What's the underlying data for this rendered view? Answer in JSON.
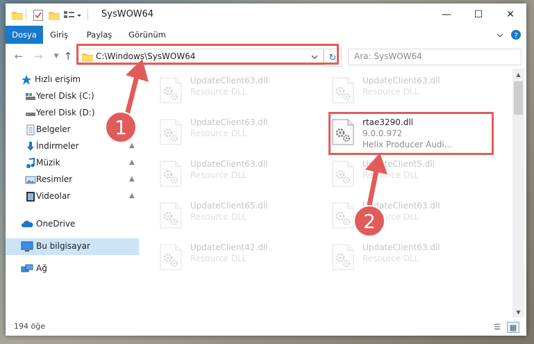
{
  "window": {
    "title": "SysWOW64",
    "controls": {
      "minimize": "—",
      "maximize": "☐",
      "close": "✕"
    }
  },
  "ribbon": {
    "tabs": [
      {
        "label": "Dosya"
      },
      {
        "label": "Giriş"
      },
      {
        "label": "Paylaş"
      },
      {
        "label": "Görünüm"
      }
    ],
    "expand_icon": "chevron-down-icon",
    "help_icon": "help-icon"
  },
  "navbar": {
    "address": "C:\\Windows\\SysWOW64",
    "search_placeholder": "Ara: SysWOW64"
  },
  "sidebar": {
    "items": [
      {
        "label": "Hızlı erişim",
        "icon": "star-icon"
      },
      {
        "label": "Yerel Disk (C:)",
        "icon": "drive-icon"
      },
      {
        "label": "Yerel Disk (D:)",
        "icon": "drive-icon"
      },
      {
        "label": "Belgeler",
        "icon": "documents-icon"
      },
      {
        "label": "İndirmeler",
        "icon": "download-icon"
      },
      {
        "label": "Müzik",
        "icon": "music-icon"
      },
      {
        "label": "Resimler",
        "icon": "pictures-icon"
      },
      {
        "label": "Videolar",
        "icon": "videos-icon"
      },
      {
        "label": "OneDrive",
        "icon": "cloud-icon"
      },
      {
        "label": "Bu bilgisayar",
        "icon": "computer-icon"
      },
      {
        "label": "Ağ",
        "icon": "network-icon"
      }
    ]
  },
  "files": [
    {
      "name": "UpdateClient63.dll",
      "type": "Resource DLL"
    },
    {
      "name": "UpdateClient63.dll",
      "type": "Resource DLL"
    },
    {
      "name": "UpdateClient63.dll",
      "type": "Resource DLL"
    },
    {
      "name": "rtae3290.dll",
      "version": "9.0.0.972",
      "description": "Helix Producer Audi..."
    },
    {
      "name": "UpdateClient63.dll",
      "type": "Resource DLL"
    },
    {
      "name": "UpdateClient5.dll",
      "type": "Resource DLL"
    },
    {
      "name": "UpdateClient65.dll",
      "type": "Resource DLL"
    },
    {
      "name": "UpdateClient63.dll",
      "type": "Resource DLL"
    },
    {
      "name": "UpdateClient42.dll",
      "type": "Resource DLL"
    },
    {
      "name": "UpdateClient63.dll",
      "type": "Resource DLL"
    }
  ],
  "status": {
    "count": "194 öğe"
  },
  "annotations": {
    "step1": "1",
    "step2": "2",
    "color": "#e25b5b"
  }
}
